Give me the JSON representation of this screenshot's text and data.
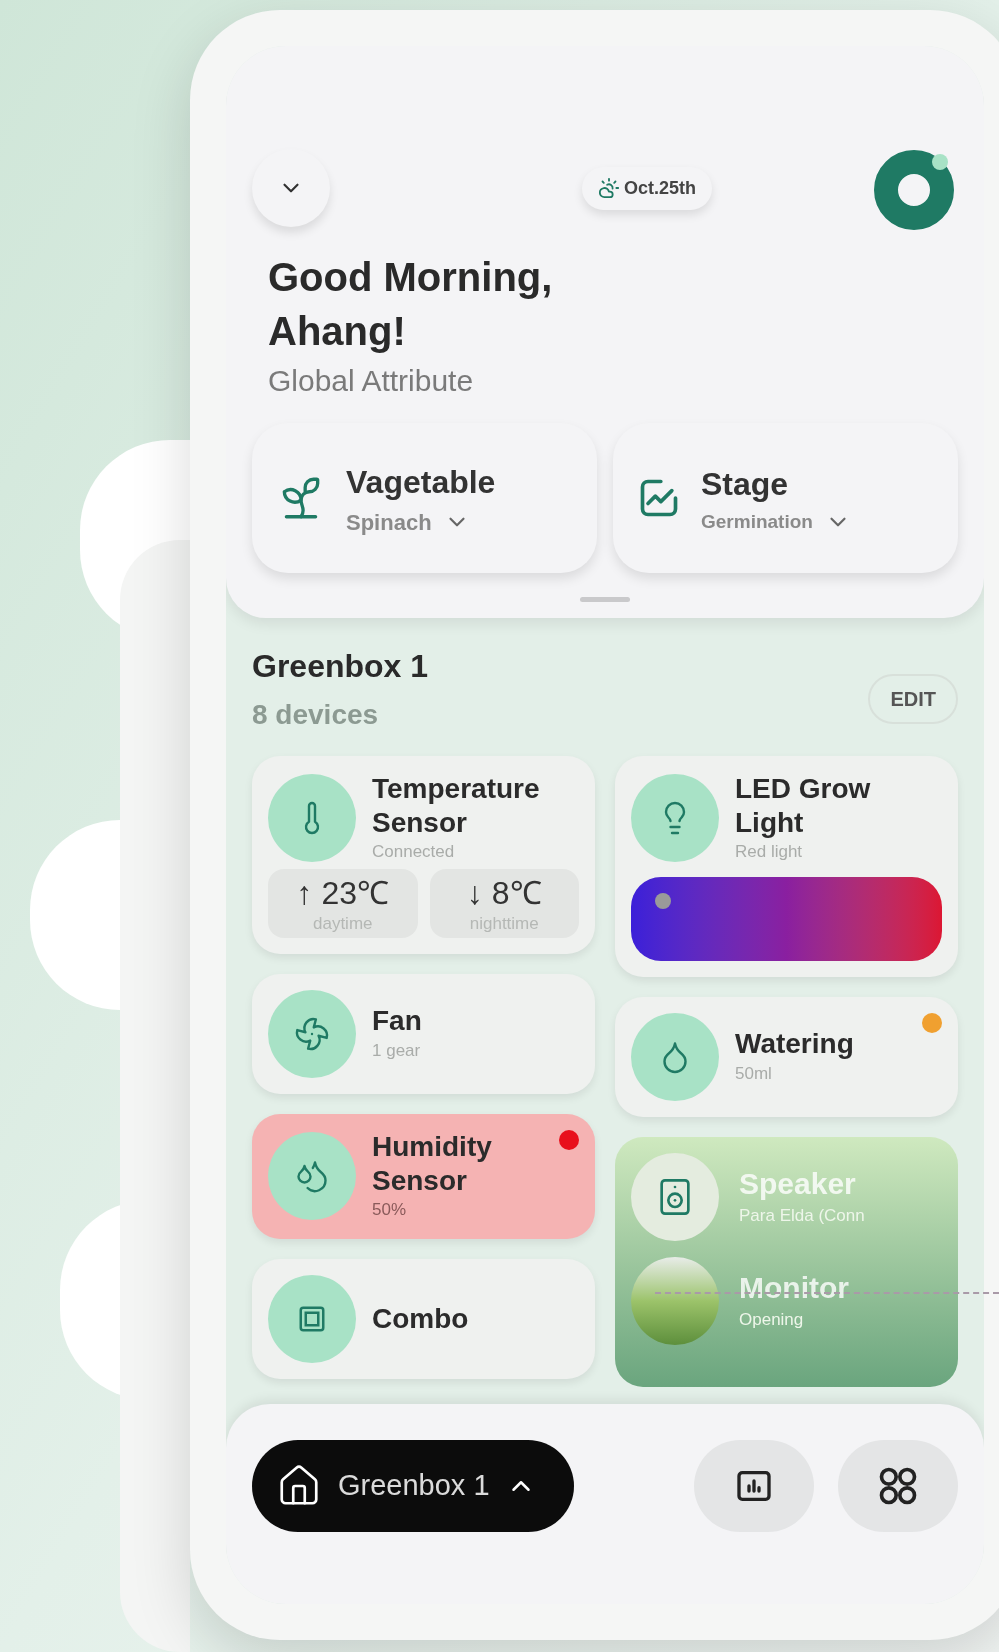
{
  "header": {
    "date": "Oct.25th",
    "greeting": "Good Morning, Ahang!",
    "subtitle": "Global Attribute"
  },
  "attributes": [
    {
      "kind": "plant",
      "label": "Vagetable",
      "value": "Spinach"
    },
    {
      "kind": "stage",
      "label": "Stage",
      "value": "Germination"
    }
  ],
  "group": {
    "title": "Greenbox 1",
    "count": "8 devices",
    "edit": "EDIT"
  },
  "columns": [
    [
      {
        "kind": "temperature",
        "name": "Temperature Sensor",
        "status": "Connected",
        "alert": false,
        "readings": [
          {
            "arrow": "↑",
            "value": "23℃",
            "label": "daytime"
          },
          {
            "arrow": "↓",
            "value": "8℃",
            "label": "nighttime"
          }
        ]
      },
      {
        "kind": "fan",
        "name": "Fan",
        "status": "1 gear",
        "alert": false
      },
      {
        "kind": "humidity",
        "name": "Humidity Sensor",
        "status": "50%",
        "alert": true,
        "color": "#e8101c"
      },
      {
        "kind": "combo",
        "name": "Combo",
        "alert": false
      }
    ],
    [
      {
        "kind": "light",
        "name": "LED Grow Light",
        "status": "Red light",
        "alert": false,
        "level": 0.05
      },
      {
        "kind": "watering",
        "name": "Watering",
        "status": "50ml",
        "alert": false,
        "color": "#f0a030"
      },
      {
        "kind": "media",
        "items": [
          {
            "kind": "speaker",
            "name": "Speaker",
            "status": "Para Elda (Conn"
          },
          {
            "kind": "monitor",
            "name": "Monitor",
            "status": "Opening"
          }
        ]
      }
    ]
  ],
  "nav": {
    "home_label": "Greenbox 1"
  }
}
